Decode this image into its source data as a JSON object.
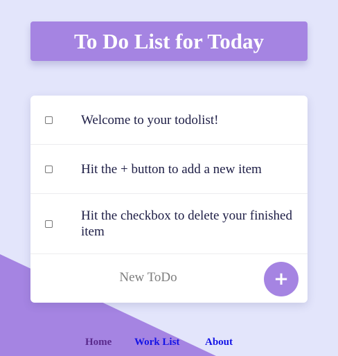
{
  "page": {
    "title": "To Do List for Today"
  },
  "todos": [
    {
      "text": "Welcome to your todolist!",
      "checked": false
    },
    {
      "text": "Hit the + button to add a new item",
      "checked": false
    },
    {
      "text": "Hit the checkbox to delete your finished item",
      "checked": false
    }
  ],
  "new_todo": {
    "placeholder": "New ToDo",
    "value": ""
  },
  "add_button": {
    "label": "+"
  },
  "nav": {
    "items": [
      {
        "label": "Home",
        "visited": true
      },
      {
        "label": "Work List",
        "visited": false
      },
      {
        "label": "About",
        "visited": false
      }
    ]
  },
  "colors": {
    "background": "#e3e5fb",
    "accent": "#a584e2",
    "card": "#ffffff",
    "item_text": "#1d1d45",
    "link": "#1414e6",
    "link_visited": "#5a2a8c"
  }
}
